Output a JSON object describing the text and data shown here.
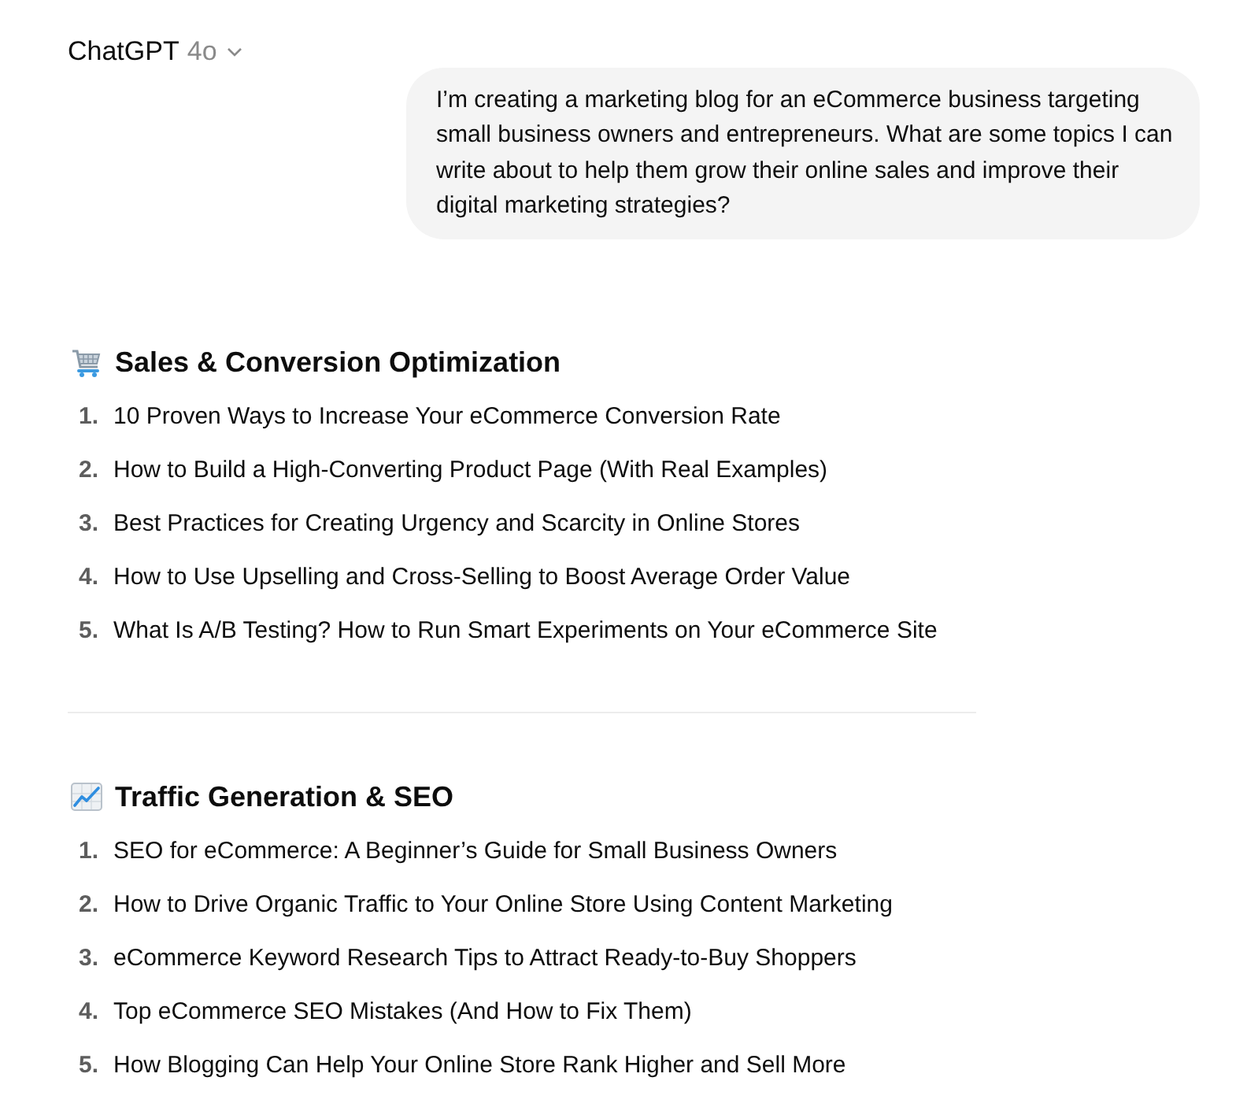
{
  "header": {
    "title": "ChatGPT",
    "model": "4o"
  },
  "user_message": {
    "text": "I’m creating a marketing blog for an eCommerce business targeting small business owners and entrepreneurs. What are some topics I can write about to help them grow their online sales and improve their digital marketing strategies?"
  },
  "response": {
    "sections": [
      {
        "kind": "sales",
        "heading": "Sales & Conversion Optimization",
        "items": [
          {
            "number": "1.",
            "text": "10 Proven Ways to Increase Your eCommerce Conversion Rate"
          },
          {
            "number": "2.",
            "text": "How to Build a High-Converting Product Page (With Real Examples)"
          },
          {
            "number": "3.",
            "text": "Best Practices for Creating Urgency and Scarcity in Online Stores"
          },
          {
            "number": "4.",
            "text": "How to Use Upselling and Cross-Selling to Boost Average Order Value"
          },
          {
            "number": "5.",
            "text": "What Is A/B Testing? How to Run Smart Experiments on Your eCommerce Site"
          }
        ]
      },
      {
        "kind": "traffic",
        "heading": "Traffic Generation & SEO",
        "items": [
          {
            "number": "1.",
            "text": "SEO for eCommerce: A Beginner’s Guide for Small Business Owners"
          },
          {
            "number": "2.",
            "text": "How to Drive Organic Traffic to Your Online Store Using Content Marketing"
          },
          {
            "number": "3.",
            "text": "eCommerce Keyword Research Tips to Attract Ready-to-Buy Shoppers"
          },
          {
            "number": "4.",
            "text": "Top eCommerce SEO Mistakes (And How to Fix Them)"
          },
          {
            "number": "5.",
            "text": "How Blogging Can Help Your Online Store Rank Higher and Sell More"
          }
        ]
      }
    ]
  }
}
